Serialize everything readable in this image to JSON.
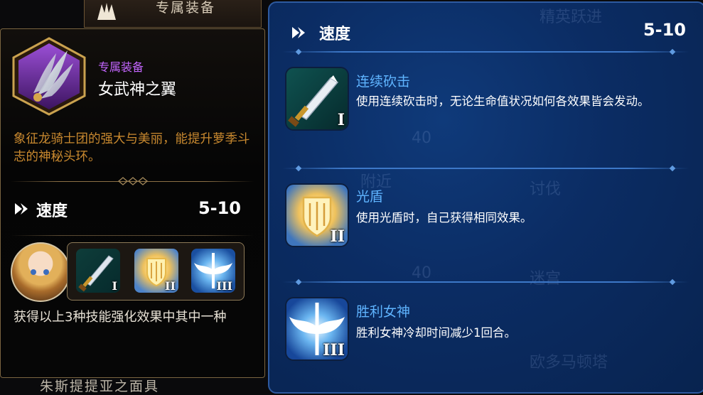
{
  "top_tab": {
    "label": "专属装备"
  },
  "equipment": {
    "category": "专属装备",
    "name": "女武神之翼",
    "description": "象征龙骑士团的强大与美丽，能提升萝季斗志的神秘头环。",
    "stat_label": "速度",
    "stat_value": "5-10",
    "choice_text": "获得以上3种技能强化效果中其中一种",
    "next_item_partial": "朱斯提提亚之面具",
    "icon": "wing-icon"
  },
  "tooltip": {
    "stat_label": "速度",
    "stat_value": "5-10",
    "skills": [
      {
        "name": "连续砍击",
        "desc": "使用连续砍击时，无论生命值状况如何各效果皆会发动。",
        "roman": "I",
        "icon": "sword-icon"
      },
      {
        "name": "光盾",
        "desc": "使用光盾时，自己获得相同效果。",
        "roman": "II",
        "icon": "light-shield-icon"
      },
      {
        "name": "胜利女神",
        "desc": "胜利女神冷却时间减少1回合。",
        "roman": "III",
        "icon": "winged-light-icon"
      }
    ]
  },
  "mini_skills": [
    {
      "roman": "I",
      "icon": "sword-icon"
    },
    {
      "roman": "II",
      "icon": "light-shield-icon"
    },
    {
      "roman": "III",
      "icon": "winged-light-icon"
    }
  ],
  "background_ghost_text": [
    "精英跃进",
    "讨伐",
    "迷宫",
    "欧多马顿塔",
    "40",
    "40",
    "附近"
  ]
}
